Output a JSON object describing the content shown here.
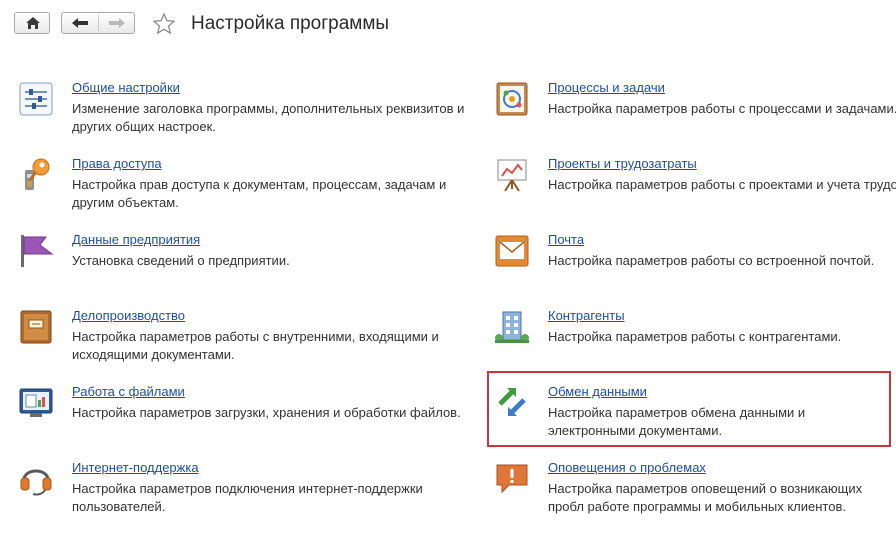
{
  "header": {
    "title": "Настройка программы",
    "home_icon": "home-icon",
    "back_icon": "arrow-left-icon",
    "forward_icon": "arrow-right-icon",
    "favorite_icon": "star-icon"
  },
  "left_items": [
    {
      "title": "Общие настройки",
      "desc": "Изменение заголовка программы, дополнительных реквизитов и других общих настроек.",
      "icon": "sliders-icon"
    },
    {
      "title": "Права доступа",
      "desc": "Настройка прав доступа к документам, процессам, задачам и другим объектам.",
      "icon": "key-icon"
    },
    {
      "title": "Данные предприятия",
      "desc": "Установка сведений о предприятии.",
      "icon": "flag-icon"
    },
    {
      "title": "Делопроизводство",
      "desc": "Настройка параметров работы с внутренними, входящими и исходящими документами.",
      "icon": "folder-icon"
    },
    {
      "title": "Работа с файлами",
      "desc": "Настройка параметров загрузки, хранения и обработки файлов.",
      "icon": "monitor-icon"
    },
    {
      "title": "Интернет-поддержка",
      "desc": "Настройка параметров подключения интернет-поддержки пользователей.",
      "icon": "headset-icon"
    }
  ],
  "right_items": [
    {
      "title": "Процессы и задачи",
      "desc": "Настройка параметров работы с процессами и задачами.",
      "icon": "process-icon"
    },
    {
      "title": "Проекты и трудозатраты",
      "desc": "Настройка параметров работы с проектами и учета трудоз",
      "icon": "easel-chart-icon"
    },
    {
      "title": "Почта",
      "desc": "Настройка параметров работы со встроенной почтой.",
      "icon": "mail-icon"
    },
    {
      "title": "Контрагенты",
      "desc": "Настройка параметров работы с контрагентами.",
      "icon": "building-icon"
    },
    {
      "title": "Обмен данными",
      "desc": "Настройка параметров обмена данными и электронными документами.",
      "icon": "exchange-arrows-icon"
    },
    {
      "title": "Оповещения о проблемах",
      "desc": "Настройка параметров оповещений о возникающих пробл работе программы и мобильных клиентов.",
      "icon": "alert-bubble-icon"
    }
  ],
  "colors": {
    "link": "#1c4f9c",
    "highlight": "#d0343b",
    "text": "#333333"
  }
}
